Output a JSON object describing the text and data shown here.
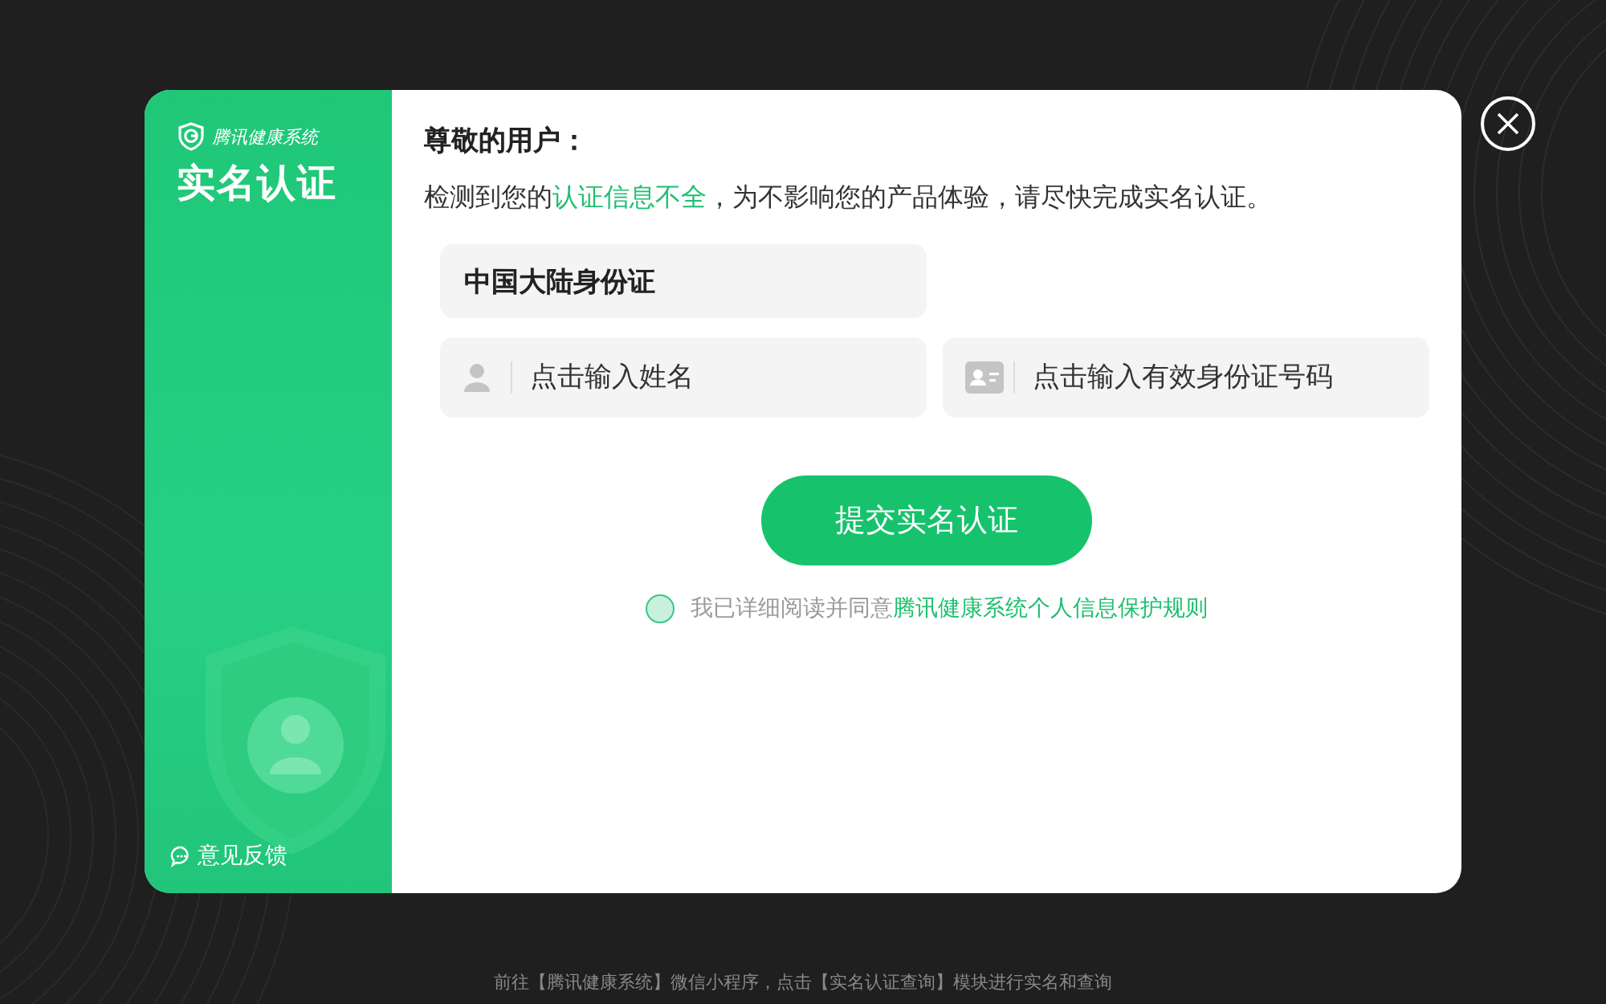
{
  "sidebar": {
    "brand": "腾讯健康系统",
    "title": "实名认证",
    "feedback": "意见反馈"
  },
  "greeting": "尊敬的用户：",
  "notice": [
    {
      "text": "检测到您的",
      "highlight": false
    },
    {
      "text": "认证信息不全",
      "highlight": true
    },
    {
      "text": "，为不影响您的产品体验，请尽快完成实名认证。",
      "highlight": false
    }
  ],
  "id_type": "中国大陆身份证",
  "fields": [
    {
      "kind": "name",
      "placeholder": "点击输入姓名"
    },
    {
      "kind": "id",
      "placeholder": "点击输入有效身份证号码"
    }
  ],
  "submit": "提交实名认证",
  "agreement": {
    "checked": false,
    "text": "我已详细阅读并同意",
    "link": "腾讯健康系统个人信息保护规则"
  },
  "footer": "前往【腾讯健康系统】微信小程序，点击【实名认证查询】模块进行实名和查询"
}
